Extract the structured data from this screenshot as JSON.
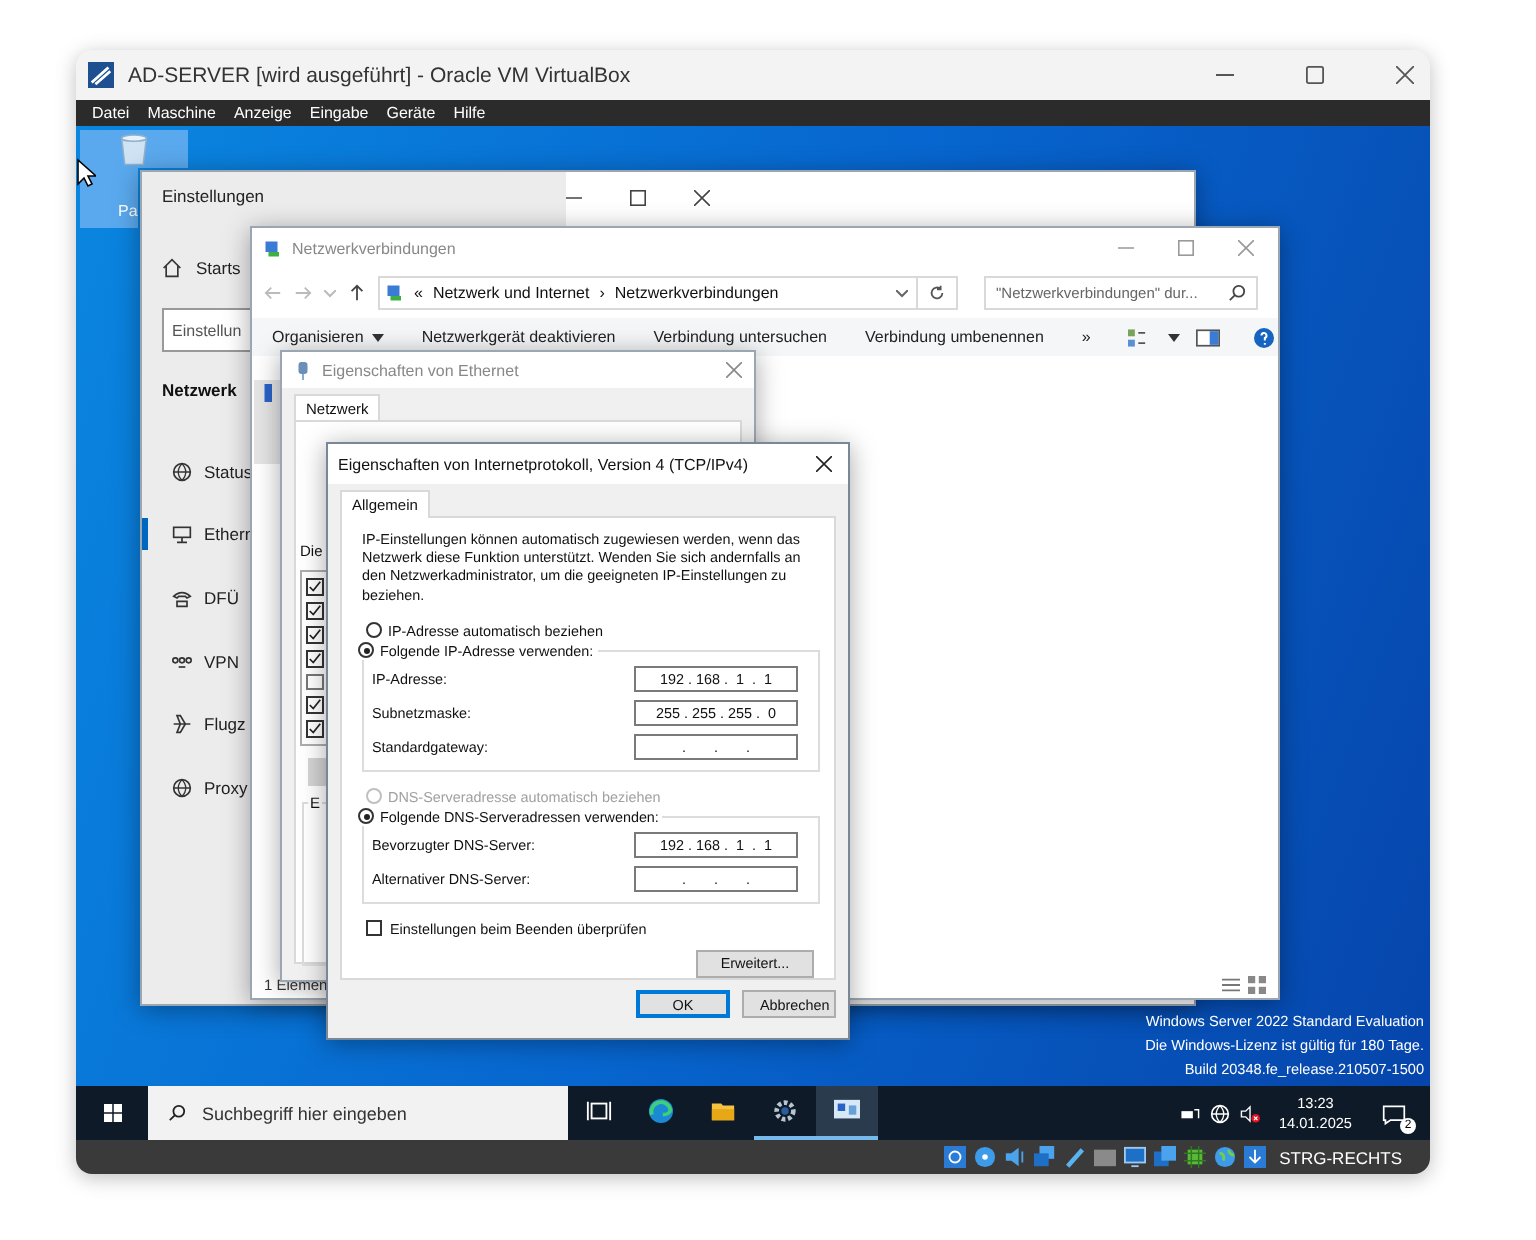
{
  "vbox": {
    "title": "AD-SERVER [wird ausgeführt] - Oracle VM VirtualBox",
    "menu": [
      "Datei",
      "Maschine",
      "Anzeige",
      "Eingabe",
      "Geräte",
      "Hilfe"
    ],
    "host_key": "STRG-RECHTS"
  },
  "desktop": {
    "recycle_bin_label": "Pa",
    "edition_lines": [
      "Windows Server 2022 Standard Evaluation",
      "Die Windows-Lizenz ist gültig für 180 Tage.",
      "Build 20348.fe_release.210507-1500"
    ]
  },
  "settings_window": {
    "title": "Einstellungen",
    "home": "Starts",
    "search_placeholder": "Einstellun",
    "section": "Netzwerk",
    "nav": [
      {
        "kind": "status",
        "label": "Status",
        "selected": false
      },
      {
        "kind": "ethernet",
        "label": "Ethern",
        "selected": true
      },
      {
        "kind": "dialup",
        "label": "DFÜ",
        "selected": false
      },
      {
        "kind": "vpn",
        "label": "VPN",
        "selected": false
      },
      {
        "kind": "airplane",
        "label": "Flugz",
        "selected": false
      },
      {
        "kind": "proxy",
        "label": "Proxy",
        "selected": false
      }
    ]
  },
  "network_window": {
    "title": "Netzwerkverbindungen",
    "breadcrumb_prefix": "«",
    "breadcrumb": [
      "Netzwerk und Internet",
      "Netzwerkverbindungen"
    ],
    "breadcrumb_separator": "›",
    "search_placeholder": "\"Netzwerkverbindungen\" dur...",
    "toolbar": [
      "Organisieren",
      "Netzwerkgerät deaktivieren",
      "Verbindung untersuchen",
      "Verbindung umbenennen"
    ],
    "overflow": "»",
    "status": "1 Elemen"
  },
  "ethernet_dialog": {
    "title": "Eigenschaften von Ethernet",
    "tabs": [
      {
        "label": "Netzwerk",
        "selected": true
      }
    ],
    "list_label": "Die",
    "components": [
      {
        "checked": true
      },
      {
        "checked": true
      },
      {
        "checked": true
      },
      {
        "checked": true
      },
      {
        "checked": false
      },
      {
        "checked": true
      },
      {
        "checked": true
      }
    ],
    "description_label": "E"
  },
  "tcp_dialog": {
    "title": "Eigenschaften von Internetprotokoll, Version 4 (TCP/IPv4)",
    "tabs": [
      {
        "label": "Allgemein",
        "selected": true
      }
    ],
    "info": "IP-Einstellungen können automatisch zugewiesen werden, wenn das Netzwerk diese Funktion unterstützt. Wenden Sie sich andernfalls an den Netzwerkadministrator, um die geeigneten IP-Einstellungen zu beziehen.",
    "ip_mode": [
      {
        "label": "IP-Adresse automatisch beziehen",
        "selected": false,
        "disabled": false
      },
      {
        "label": "Folgende IP-Adresse verwenden:",
        "selected": true,
        "disabled": false
      }
    ],
    "ip_fields": [
      {
        "label": "IP-Adresse:",
        "value": "192 . 168 .  1  .  1"
      },
      {
        "label": "Subnetzmaske:",
        "value": "255 . 255 . 255 .  0"
      },
      {
        "label": "Standardgateway:",
        "value": ".       .       ."
      }
    ],
    "dns_mode": [
      {
        "label": "DNS-Serveradresse automatisch beziehen",
        "selected": false,
        "disabled": true
      },
      {
        "label": "Folgende DNS-Serveradressen verwenden:",
        "selected": true,
        "disabled": false
      }
    ],
    "dns_fields": [
      {
        "label": "Bevorzugter DNS-Server:",
        "value": "192 . 168 .  1  .  1"
      },
      {
        "label": "Alternativer DNS-Server:",
        "value": ".       .       ."
      }
    ],
    "validate": {
      "label": "Einstellungen beim Beenden überprüfen",
      "checked": false
    },
    "advanced_button": "Erweitert...",
    "buttons": [
      {
        "label": "OK",
        "default": true
      },
      {
        "label": "Abbrechen",
        "default": false
      }
    ]
  },
  "taskbar": {
    "search_placeholder": "Suchbegriff hier eingeben",
    "apps": [
      {
        "kind": "taskview",
        "running": false,
        "focused": false
      },
      {
        "kind": "edge",
        "running": false,
        "focused": false
      },
      {
        "kind": "explorer",
        "running": false,
        "focused": false
      },
      {
        "kind": "settings",
        "running": true,
        "focused": false
      },
      {
        "kind": "netconn",
        "running": true,
        "focused": true
      }
    ],
    "time": "13:23",
    "date": "14.01.2025",
    "notifications": "2"
  }
}
